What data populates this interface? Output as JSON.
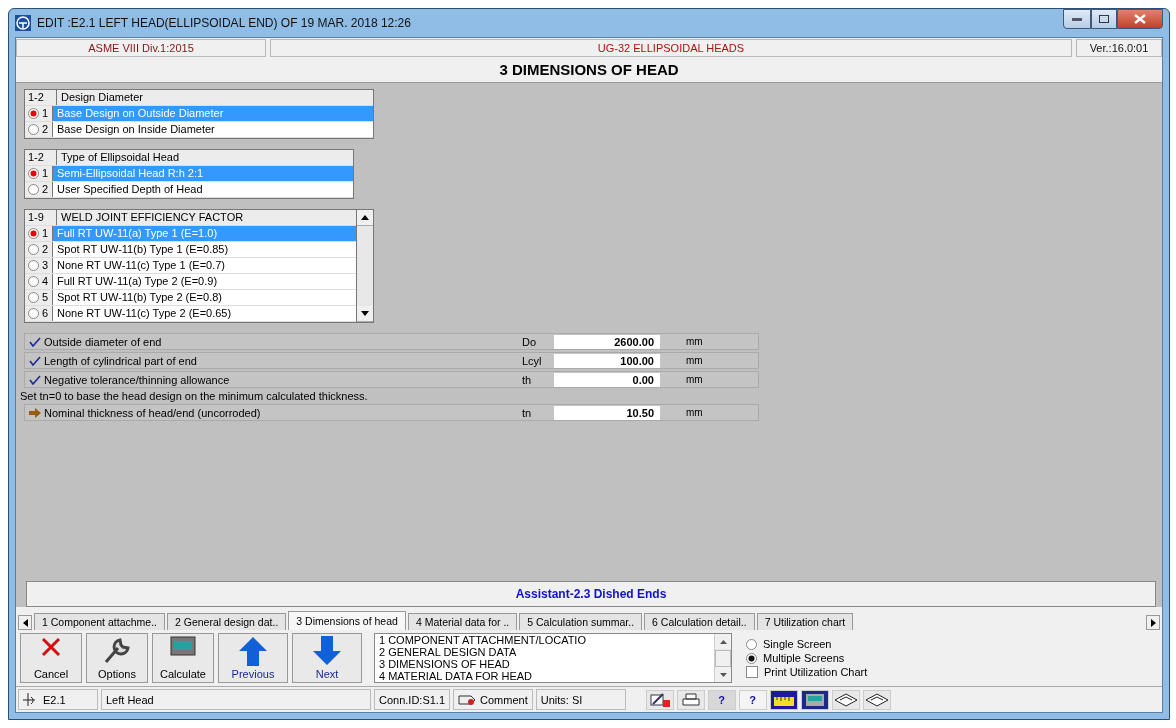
{
  "window": {
    "title": "EDIT :E2.1 LEFT HEAD(ELLIPSOIDAL END) OF 19 MAR. 2018 12:26"
  },
  "header": {
    "code": "ASME VIII Div.1:2015",
    "section": "UG-32 ELLIPSOIDAL HEADS",
    "version": "Ver.:16.0:01"
  },
  "heading": "3 DIMENSIONS OF HEAD",
  "choice_groups": [
    {
      "range": "1-2",
      "title": "Design Diameter",
      "scrollable": false,
      "options": [
        {
          "number": "1",
          "label": "Base Design on Outside Diameter",
          "selected": true
        },
        {
          "number": "2",
          "label": "Base Design on Inside Diameter",
          "selected": false
        }
      ]
    },
    {
      "range": "1-2",
      "title": "Type of Ellipsoidal Head",
      "scrollable": false,
      "options": [
        {
          "number": "1",
          "label": "Semi-Ellipsoidal Head R:h 2:1",
          "selected": true
        },
        {
          "number": "2",
          "label": "User Specified Depth of Head",
          "selected": false
        }
      ]
    },
    {
      "range": "1-9",
      "title": "WELD JOINT EFFICIENCY FACTOR",
      "scrollable": true,
      "options": [
        {
          "number": "1",
          "label": "Full RT UW-11(a) Type 1 (E=1.0)",
          "selected": true
        },
        {
          "number": "2",
          "label": "Spot RT UW-11(b) Type 1 (E=0.85)",
          "selected": false
        },
        {
          "number": "3",
          "label": "None RT UW-11(c) Type 1 (E=0.7)",
          "selected": false
        },
        {
          "number": "4",
          "label": "Full RT UW-11(a) Type 2 (E=0.9)",
          "selected": false
        },
        {
          "number": "5",
          "label": "Spot RT UW-11(b) Type 2 (E=0.8)",
          "selected": false
        },
        {
          "number": "6",
          "label": "None RT UW-11(c) Type 2 (E=0.65)",
          "selected": false
        }
      ]
    }
  ],
  "fields": [
    {
      "kind": "check",
      "label": "Outside diameter of end",
      "symbol": "Do",
      "value": "2600.00",
      "unit": "mm"
    },
    {
      "kind": "check",
      "label": "Length of cylindrical part of end",
      "symbol": "Lcyl",
      "value": "100.00",
      "unit": "mm"
    },
    {
      "kind": "check",
      "label": "Negative tolerance/thinning allowance",
      "symbol": "th",
      "value": "0.00",
      "unit": "mm"
    },
    {
      "kind": "note",
      "label": "Set tn=0 to base the head design on the minimum calculated thickness."
    },
    {
      "kind": "arrow",
      "label": "Nominal thickness of head/end (uncorroded)",
      "symbol": "tn",
      "value": "10.50",
      "unit": "mm"
    }
  ],
  "assistant": "Assistant-2.3 Dished Ends",
  "tabs": [
    {
      "label": "1 Component attachme..",
      "selected": false
    },
    {
      "label": "2 General design dat..",
      "selected": false
    },
    {
      "label": "3 Dimensions of head",
      "selected": true
    },
    {
      "label": "4 Material data for ..",
      "selected": false
    },
    {
      "label": "5 Calculation summar..",
      "selected": false
    },
    {
      "label": "6 Calculation detail..",
      "selected": false
    },
    {
      "label": "7 Utilization chart",
      "selected": false
    }
  ],
  "toolbar_buttons": [
    {
      "kind": "cancel",
      "label": "Cancel"
    },
    {
      "kind": "options",
      "label": "Options"
    },
    {
      "kind": "calculate",
      "label": "Calculate"
    },
    {
      "kind": "previous",
      "label": "Previous"
    },
    {
      "kind": "next",
      "label": "Next"
    }
  ],
  "screen_list": [
    "1 COMPONENT ATTACHMENT/LOCATIO",
    "2 GENERAL DESIGN DATA",
    "3 DIMENSIONS OF HEAD",
    "4 MATERIAL DATA FOR HEAD"
  ],
  "view_modes": [
    {
      "label": "Single Screen",
      "selected": false
    },
    {
      "label": "Multiple Screens",
      "selected": true
    }
  ],
  "print_chart": {
    "label": "Print Utilization Chart",
    "checked": false
  },
  "status_bar": {
    "id": "E2.1",
    "name": "Left Head",
    "connection": "Conn.ID:S1.1",
    "comment": "Comment",
    "units": "Units: SI"
  },
  "status_tools": [
    {
      "kind": "edit"
    },
    {
      "kind": "print"
    },
    {
      "kind": "help",
      "glyph": "?"
    },
    {
      "kind": "context-help",
      "glyph": "?"
    },
    {
      "kind": "ruler"
    },
    {
      "kind": "calculator"
    },
    {
      "kind": "disk"
    },
    {
      "kind": "disk"
    }
  ]
}
